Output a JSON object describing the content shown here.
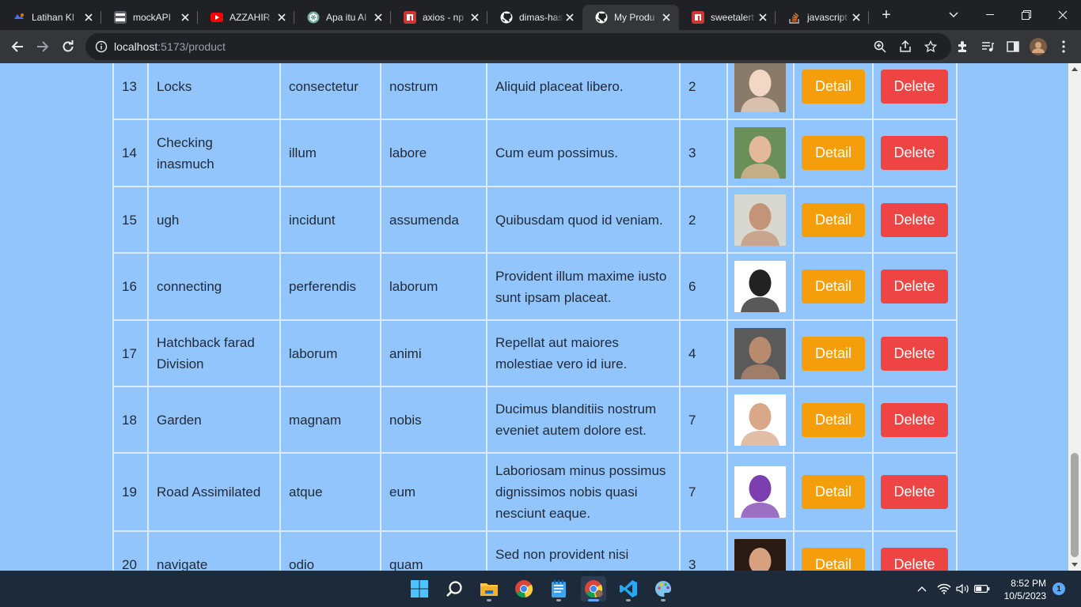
{
  "browser": {
    "tabs": [
      {
        "title": "Latihan KI",
        "favicon": "orange-dot-icon",
        "color": "#e8710a"
      },
      {
        "title": "mockAPI",
        "favicon": "mockapi-icon",
        "color": "#5f6368"
      },
      {
        "title": "AZZAHIR",
        "favicon": "youtube-icon",
        "color": "#ff0000"
      },
      {
        "title": "Apa itu AI",
        "favicon": "chatgpt-icon",
        "color": "#74aa9c"
      },
      {
        "title": "axios - np",
        "favicon": "npm-icon",
        "color": "#cb3837"
      },
      {
        "title": "dimas-has",
        "favicon": "github-icon",
        "color": "#ffffff"
      },
      {
        "title": "My Produ",
        "favicon": "github-icon",
        "color": "#ffffff"
      },
      {
        "title": "sweetalert",
        "favicon": "npm-icon",
        "color": "#cb3837"
      },
      {
        "title": "javascript",
        "favicon": "stackoverflow-icon",
        "color": "#f48024"
      }
    ],
    "new_tab": "+",
    "url_host": "localhost",
    "url_path": ":5173/product"
  },
  "table": {
    "rows": [
      {
        "id": "13",
        "name": "Locks",
        "col_a": "consectetur",
        "col_b": "nostrum",
        "desc": "Aliquid placeat libero.",
        "qty": "2",
        "avatar_bg": "#8a7a6a",
        "avatar_fg": "#f1d8c4"
      },
      {
        "id": "14",
        "name": "Checking inasmuch",
        "col_a": "illum",
        "col_b": "labore",
        "desc": "Cum eum possimus.",
        "qty": "3",
        "avatar_bg": "#6b8f5a",
        "avatar_fg": "#e3b99a"
      },
      {
        "id": "15",
        "name": "ugh",
        "col_a": "incidunt",
        "col_b": "assumenda",
        "desc": "Quibusdam quod id veniam.",
        "qty": "2",
        "avatar_bg": "#d8d8d0",
        "avatar_fg": "#c49478"
      },
      {
        "id": "16",
        "name": "connecting",
        "col_a": "perferendis",
        "col_b": "laborum",
        "desc": "Provident illum maxime iusto sunt ipsam placeat.",
        "qty": "6",
        "avatar_bg": "#ffffff",
        "avatar_fg": "#222222"
      },
      {
        "id": "17",
        "name": "Hatchback farad Division",
        "col_a": "laborum",
        "col_b": "animi",
        "desc": "Repellat aut maiores molestiae vero id iure.",
        "qty": "4",
        "avatar_bg": "#5a5a5a",
        "avatar_fg": "#b88a6e"
      },
      {
        "id": "18",
        "name": "Garden",
        "col_a": "magnam",
        "col_b": "nobis",
        "desc": "Ducimus blanditiis nostrum eveniet autem dolore est.",
        "qty": "7",
        "avatar_bg": "#ffffff",
        "avatar_fg": "#d9a888"
      },
      {
        "id": "19",
        "name": "Road Assimilated",
        "col_a": "atque",
        "col_b": "eum",
        "desc": "Laboriosam minus possimus dignissimos nobis quasi nesciunt eaque.",
        "qty": "7",
        "avatar_bg": "#ffffff",
        "avatar_fg": "#7b3fb0"
      },
      {
        "id": "20",
        "name": "navigate",
        "col_a": "odio",
        "col_b": "quam",
        "desc": "Sed non provident nisi dolorum dignissimos.",
        "qty": "3",
        "avatar_bg": "#2a1a14",
        "avatar_fg": "#d9a080"
      }
    ],
    "detail_label": "Detail",
    "delete_label": "Delete"
  },
  "taskbar": {
    "time": "8:52 PM",
    "date": "10/5/2023",
    "notifications": "1"
  },
  "colors": {
    "page_bg": "#93c5fd",
    "detail_btn": "#f59e0b",
    "delete_btn": "#ef4444"
  }
}
